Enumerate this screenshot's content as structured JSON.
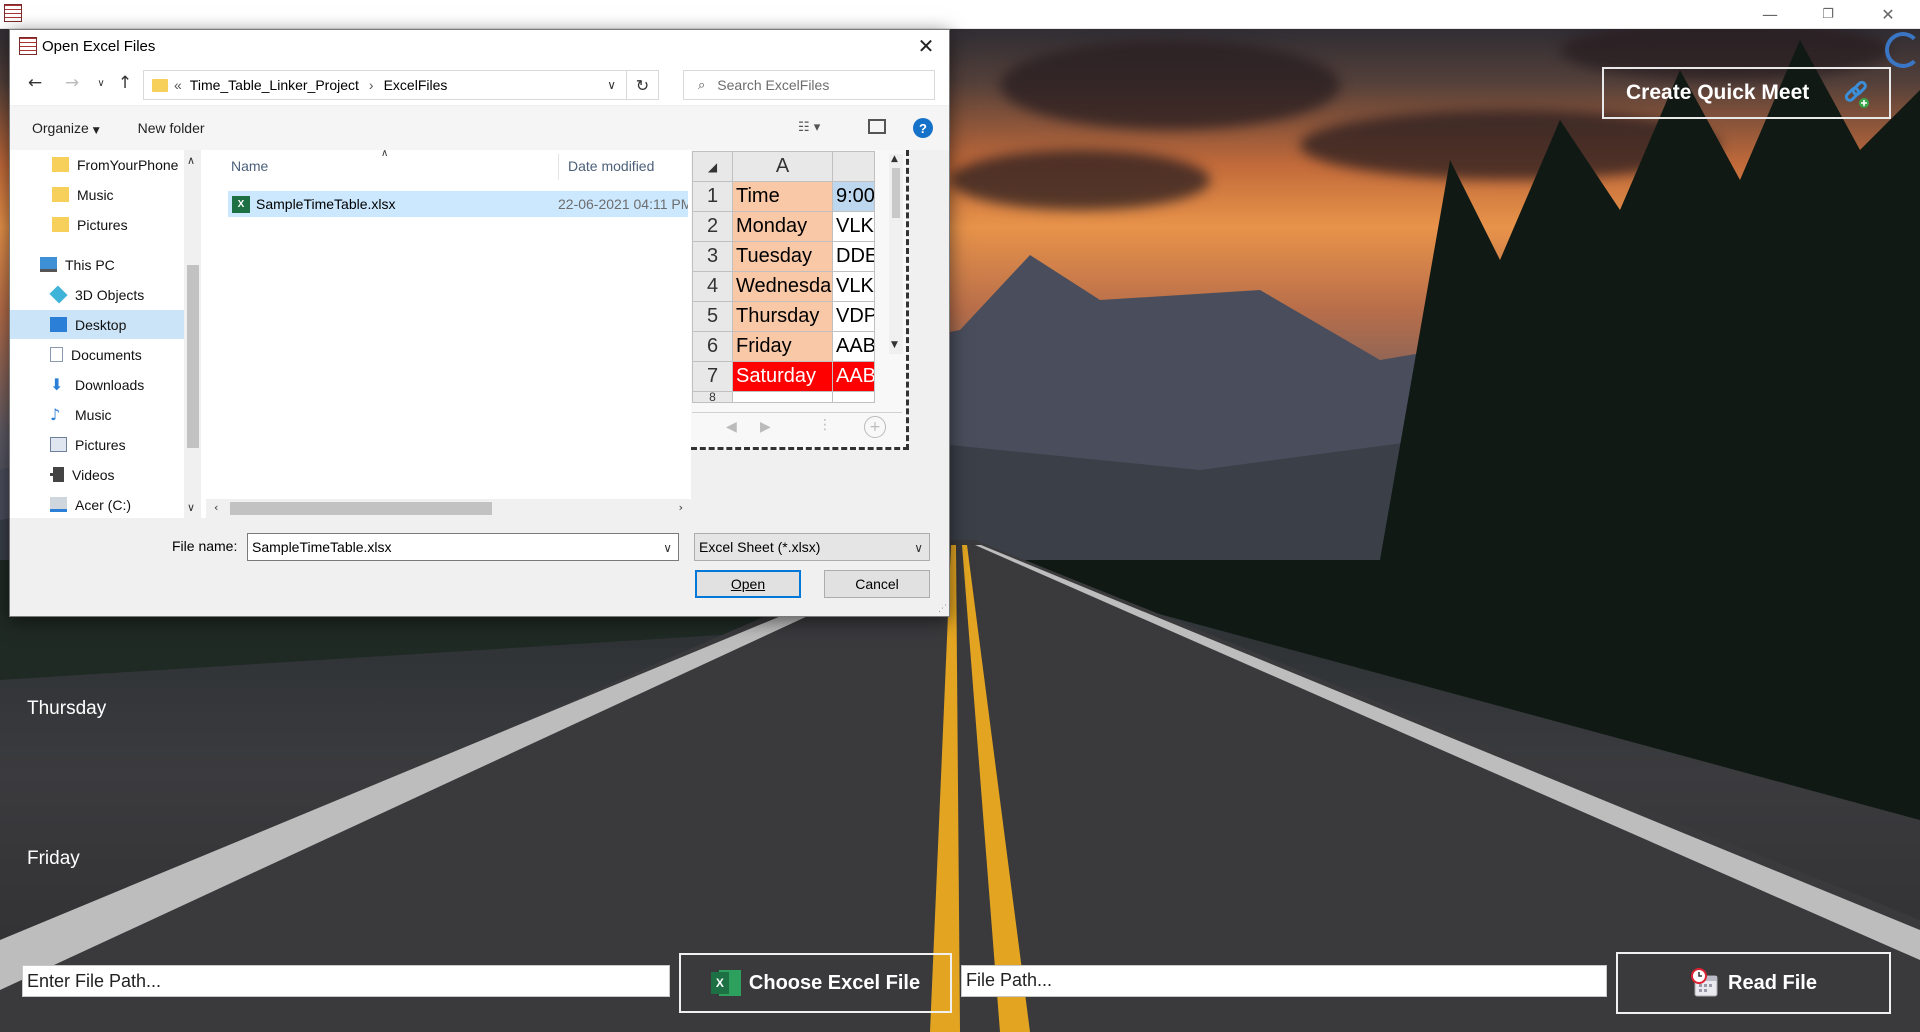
{
  "window": {
    "minimize_glyph": "—",
    "maximize_glyph": "❐",
    "close_glyph": "✕"
  },
  "quick_meet": {
    "label": "Create Quick Meet",
    "icon": "link-icon"
  },
  "day_labels": [
    "Thursday",
    "Friday"
  ],
  "bottom": {
    "file_path_placeholder": "Enter File Path...",
    "choose_label": "Choose Excel File",
    "file_path_display": "File Path...",
    "read_label": "Read File"
  },
  "dialog": {
    "title": "Open Excel Files",
    "close_glyph": "✕",
    "breadcrumb": {
      "prefix": "«",
      "folder": "Time_Table_Linker_Project",
      "separator": "›",
      "subfolder": "ExcelFiles"
    },
    "search_placeholder": "Search ExcelFiles",
    "toolbar": {
      "organize": "Organize",
      "new_folder": "New folder",
      "help": "?"
    },
    "nav_items": [
      {
        "label": "FromYourPhone",
        "icon": "folder-icon"
      },
      {
        "label": "Music",
        "icon": "folder-icon"
      },
      {
        "label": "Pictures",
        "icon": "folder-icon"
      },
      {
        "label": "This PC",
        "icon": "computer-icon"
      },
      {
        "label": "3D Objects",
        "icon": "cube-icon"
      },
      {
        "label": "Desktop",
        "icon": "desktop-icon"
      },
      {
        "label": "Documents",
        "icon": "documents-icon"
      },
      {
        "label": "Downloads",
        "icon": "download-icon"
      },
      {
        "label": "Music",
        "icon": "music-icon"
      },
      {
        "label": "Pictures",
        "icon": "pictures-icon"
      },
      {
        "label": "Videos",
        "icon": "videos-icon"
      },
      {
        "label": "Acer (C:)",
        "icon": "drive-icon"
      }
    ],
    "columns": {
      "name": "Name",
      "date": "Date modified"
    },
    "files": [
      {
        "name": "SampleTimeTable.xlsx",
        "date": "22-06-2021 04:11 PM"
      }
    ],
    "preview": {
      "column_header": "A",
      "rows": [
        {
          "n": "1",
          "a": "Time",
          "b": "9:00"
        },
        {
          "n": "2",
          "a": "Monday",
          "b": "VLK"
        },
        {
          "n": "3",
          "a": "Tuesday",
          "b": "DDE"
        },
        {
          "n": "4",
          "a": "Wednesda",
          "b": "VLK"
        },
        {
          "n": "5",
          "a": "Thursday",
          "b": "VDP"
        },
        {
          "n": "6",
          "a": "Friday",
          "b": "AAB"
        },
        {
          "n": "7",
          "a": "Saturday",
          "b": "AAB"
        },
        {
          "n": "8",
          "a": "",
          "b": ""
        }
      ]
    },
    "file_name_label": "File name:",
    "file_name_value": "SampleTimeTable.xlsx",
    "file_type": "Excel Sheet (*.xlsx)",
    "open_label": "Open",
    "cancel_label": "Cancel"
  }
}
